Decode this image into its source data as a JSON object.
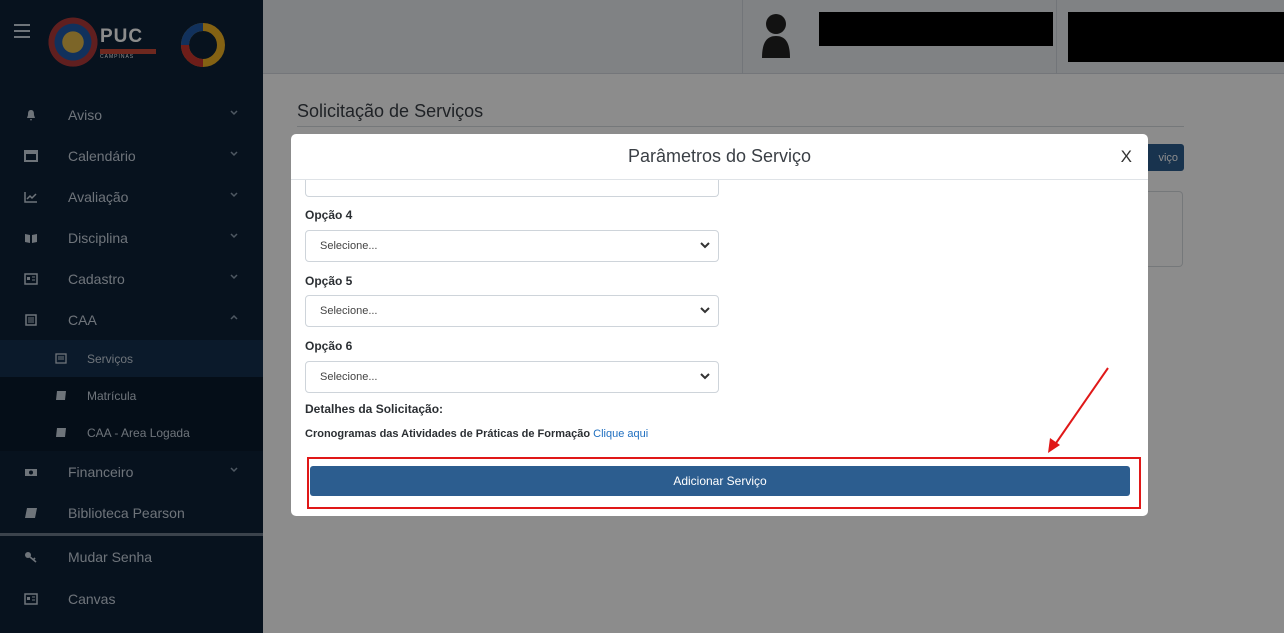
{
  "sidebar": {
    "logo_text": "PUC",
    "logo_subtext": "CAMPINAS",
    "items": [
      {
        "label": "Aviso",
        "icon": "bell-icon"
      },
      {
        "label": "Calendário",
        "icon": "calendar-icon"
      },
      {
        "label": "Avaliação",
        "icon": "chart-line-icon"
      },
      {
        "label": "Disciplina",
        "icon": "book-open-icon"
      },
      {
        "label": "Cadastro",
        "icon": "id-card-icon"
      },
      {
        "label": "CAA",
        "icon": "document-icon"
      }
    ],
    "caa_sub": [
      {
        "label": "Serviços",
        "icon": "document-icon"
      },
      {
        "label": "Matrícula",
        "icon": "book-icon"
      },
      {
        "label": "CAA - Area Logada",
        "icon": "book-icon"
      }
    ],
    "items_after": [
      {
        "label": "Financeiro",
        "icon": "money-icon"
      },
      {
        "label": "Biblioteca Pearson",
        "icon": "book-icon"
      }
    ],
    "bottom_items": [
      {
        "label": "Mudar Senha",
        "icon": "key-icon"
      },
      {
        "label": "Canvas",
        "icon": "id-card-icon"
      }
    ]
  },
  "main": {
    "page_title": "Solicitação de Serviços",
    "bg_button_label": "viço"
  },
  "modal": {
    "title": "Parâmetros do Serviço",
    "close_label": "X",
    "fields": [
      {
        "label": "Opção 4",
        "value": "Selecione..."
      },
      {
        "label": "Opção 5",
        "value": "Selecione..."
      },
      {
        "label": "Opção 6",
        "value": "Selecione..."
      }
    ],
    "details_label": "Detalhes da Solicitação:",
    "schedule_text": "Cronogramas das Atividades de Práticas de Formação",
    "schedule_link": "Clique aqui",
    "submit_label": "Adicionar Serviço"
  },
  "colors": {
    "sidebar_bg": "#0e2138",
    "primary_button": "#2c5d8f",
    "annotation_red": "#e01818"
  }
}
